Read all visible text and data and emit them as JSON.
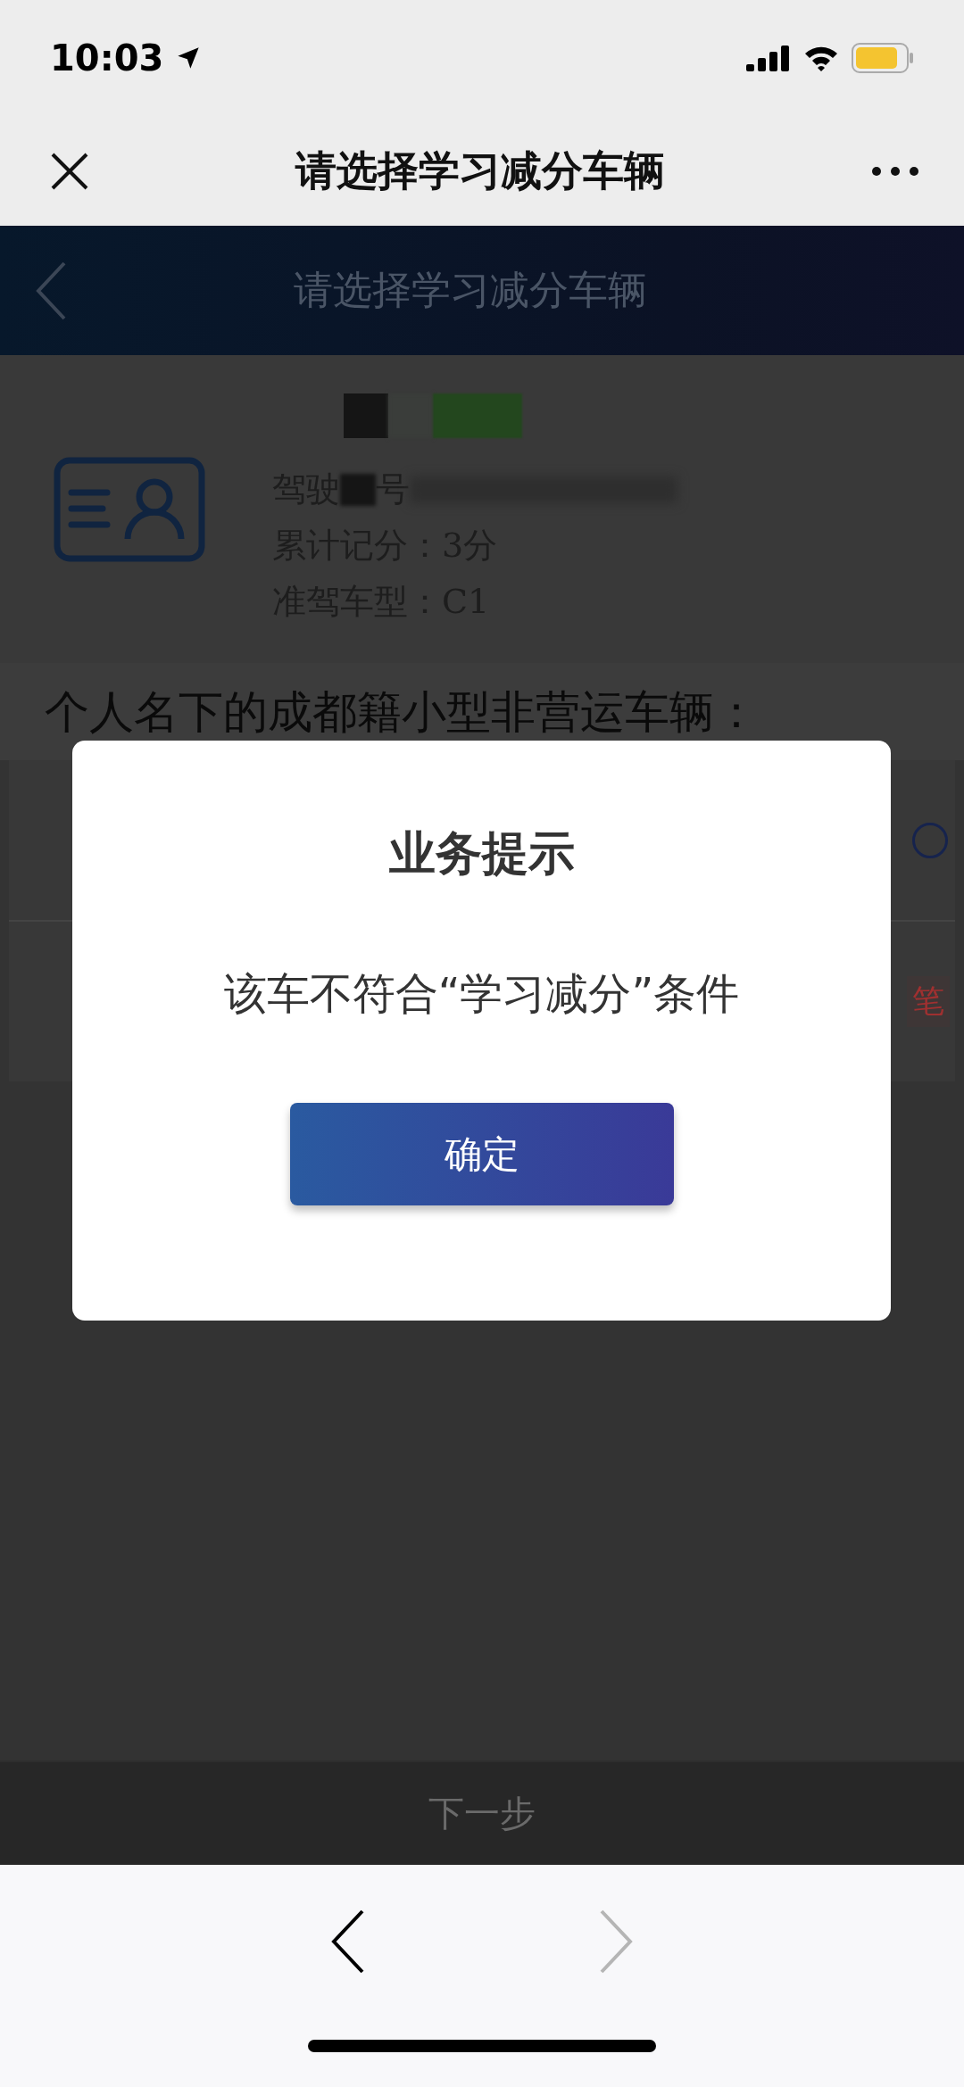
{
  "status_bar": {
    "time": "10:03"
  },
  "wechat_bar": {
    "title": "请选择学习减分车辆"
  },
  "header": {
    "title": "请选择学习减分车辆"
  },
  "driver": {
    "licence_start": "驾驶",
    "licence_end": "号",
    "points": "累计记分：3分",
    "licence_class": "准驾车型：C1"
  },
  "section_title": "个人名下的成都籍小型非营运车辆：",
  "vehicles": [
    {
      "selected": false,
      "note": "笔"
    }
  ],
  "next_button": "下一步",
  "dialog": {
    "title": "业务提示",
    "message": "该车不符合“学习减分”条件",
    "button": "确定"
  },
  "browser_bar": {
    "back_enabled": true,
    "forward_enabled": false
  }
}
